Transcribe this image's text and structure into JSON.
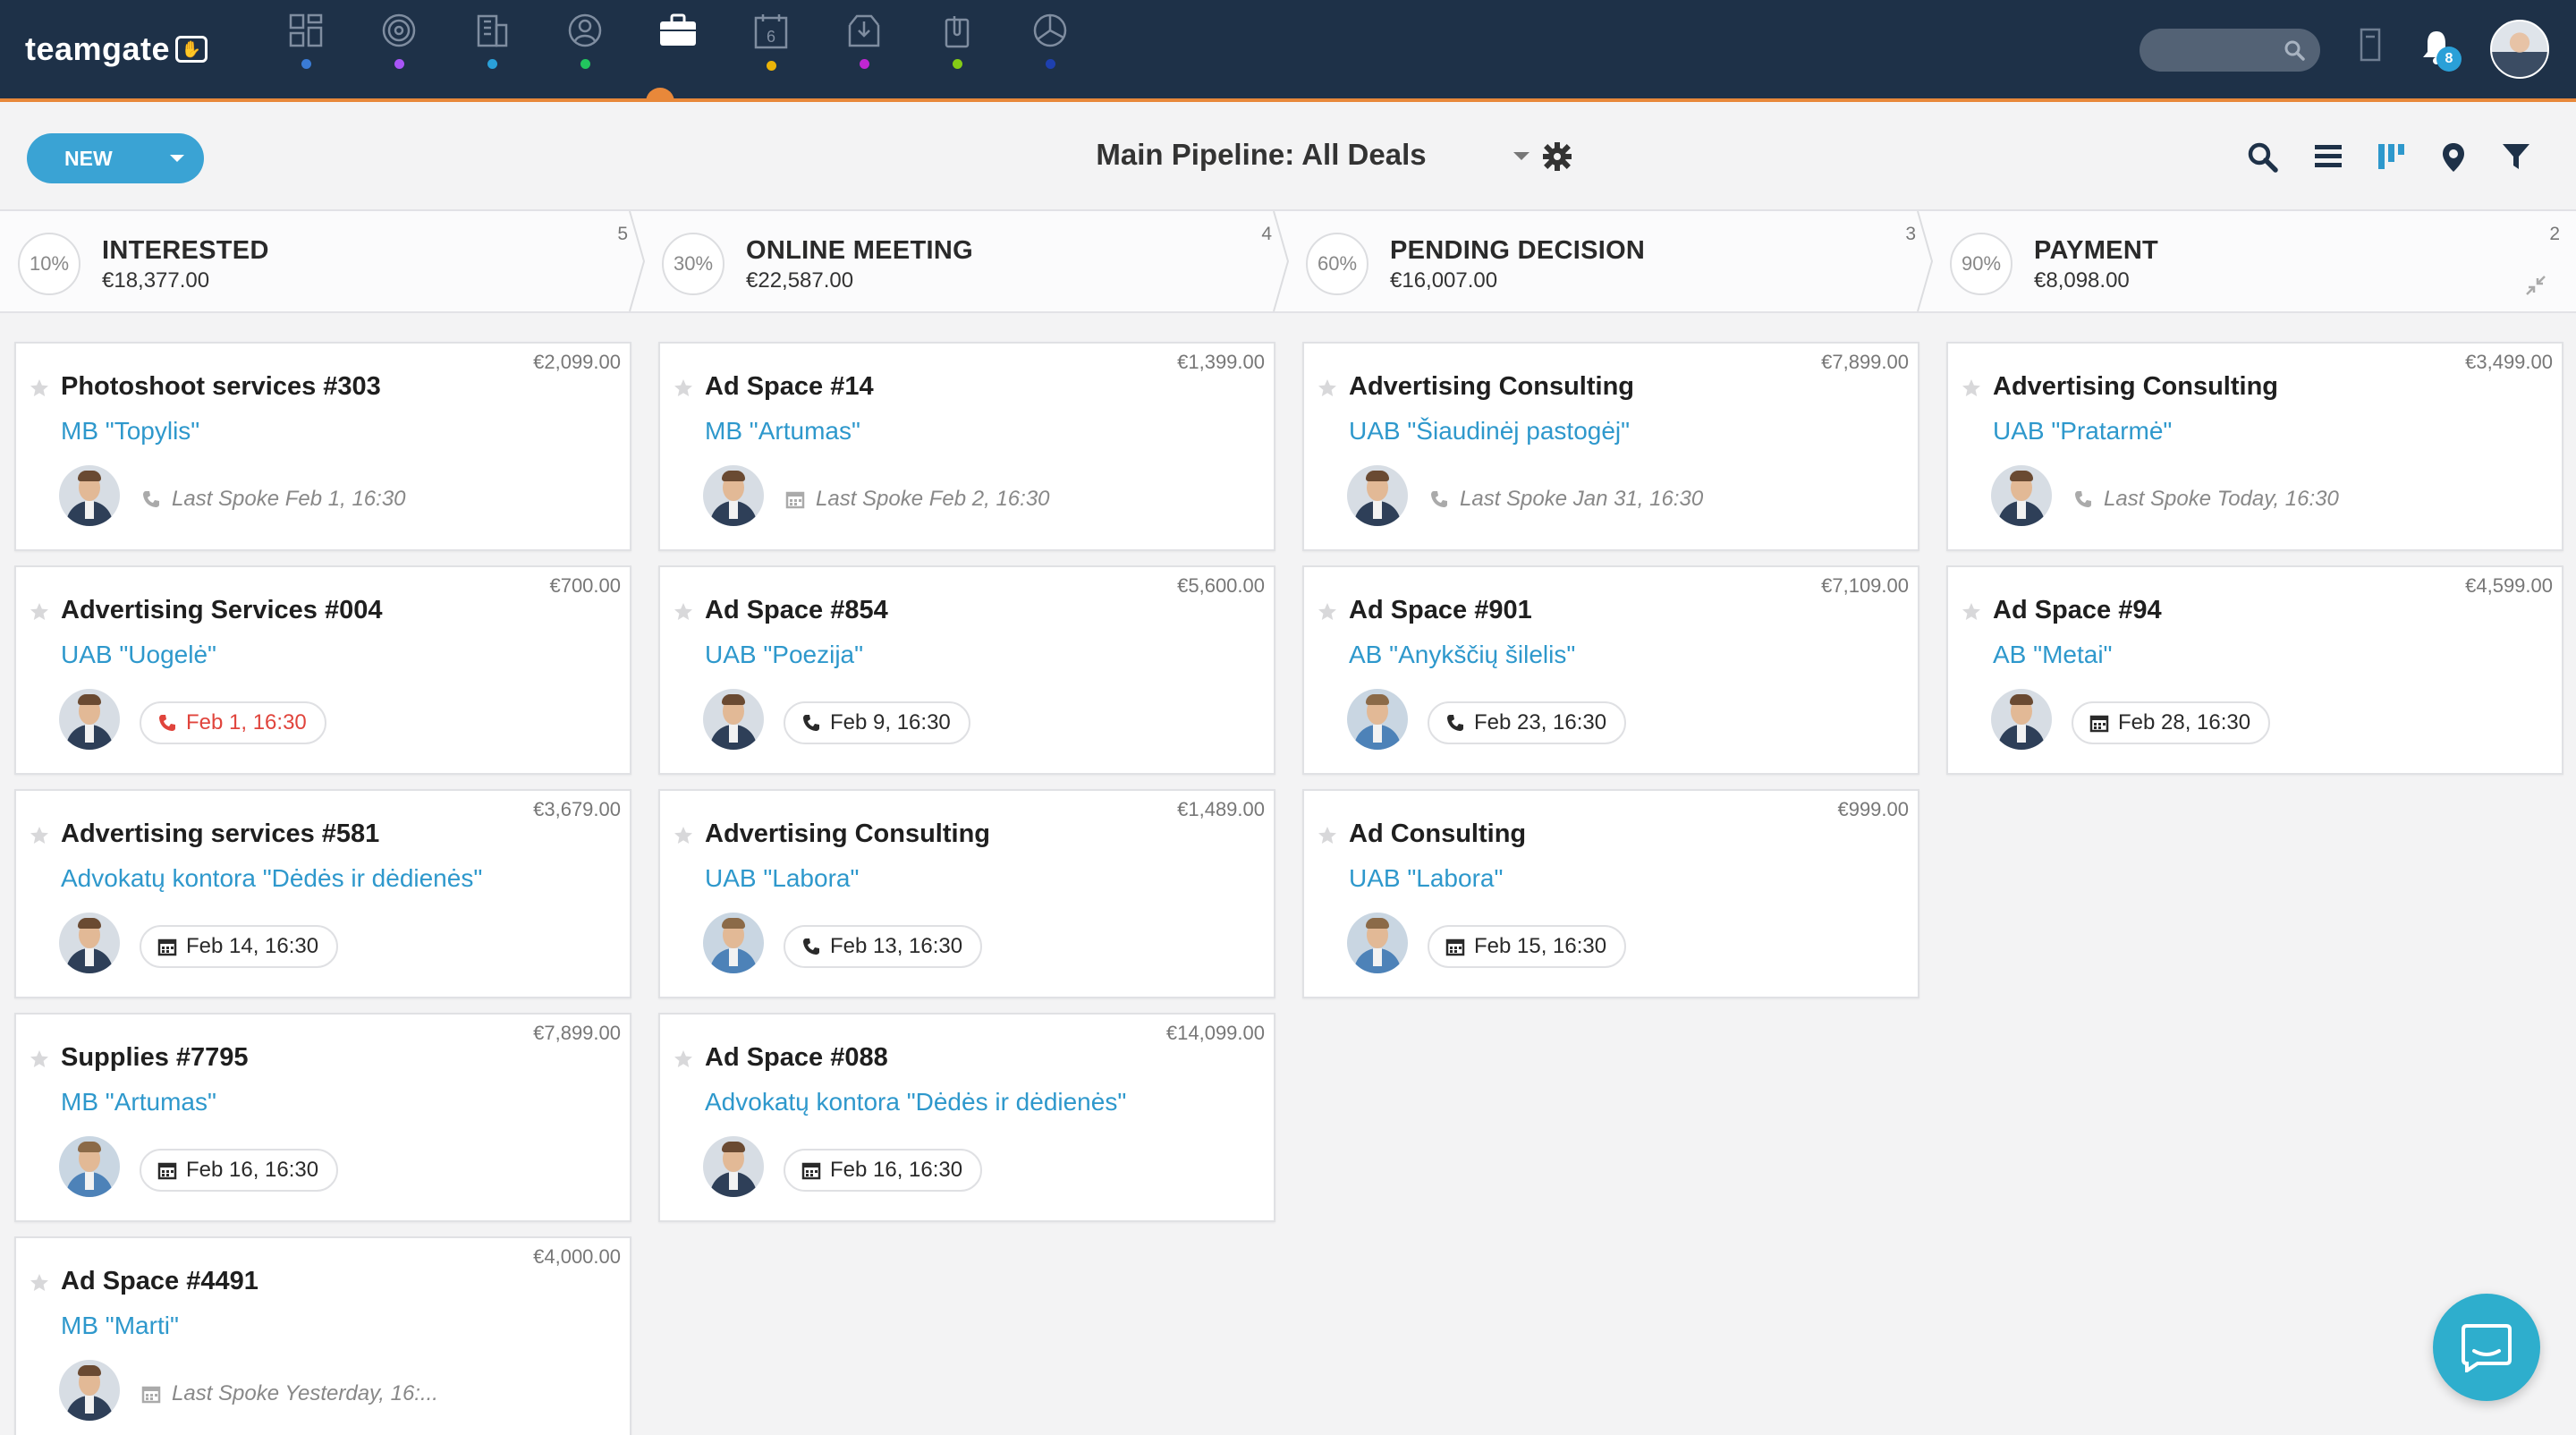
{
  "app": {
    "logo_text": "teamgate",
    "nav_items": [
      {
        "icon": "dashboard-icon",
        "dot_color": "#3a7bd5"
      },
      {
        "icon": "target-icon",
        "dot_color": "#a855f7"
      },
      {
        "icon": "companies-icon",
        "dot_color": "#2aa0d8"
      },
      {
        "icon": "people-icon",
        "dot_color": "#22c55e"
      },
      {
        "icon": "deals-briefcase-icon",
        "dot_color": "#e8883a"
      },
      {
        "icon": "calendar-icon",
        "dot_color": "#eab308",
        "text": "6"
      },
      {
        "icon": "inbox-icon",
        "dot_color": "#c026d3"
      },
      {
        "icon": "documents-icon",
        "dot_color": "#84cc16"
      },
      {
        "icon": "reports-pie-icon",
        "dot_color": "#1e40af"
      }
    ],
    "search_placeholder": "",
    "notification_count": "8"
  },
  "toolbar": {
    "new_label": "NEW",
    "pipeline_title": "Main Pipeline: All Deals"
  },
  "stages": [
    {
      "pct": "10%",
      "name": "INTERESTED",
      "amount": "€18,377.00",
      "count": "5"
    },
    {
      "pct": "30%",
      "name": "ONLINE MEETING",
      "amount": "€22,587.00",
      "count": "4"
    },
    {
      "pct": "60%",
      "name": "PENDING DECISION",
      "amount": "€16,007.00",
      "count": "3"
    },
    {
      "pct": "90%",
      "name": "PAYMENT",
      "amount": "€8,098.00",
      "count": "2"
    }
  ],
  "columns": [
    [
      {
        "amount": "€2,099.00",
        "title": "Photoshoot services #303",
        "company": "MB \"Topylis\"",
        "activity": "Last Spoke Feb 1, 16:30",
        "activity_type": "last-spoke-call",
        "avatar": "v1"
      },
      {
        "amount": "€700.00",
        "title": "Advertising Services #004",
        "company": "UAB \"Uogelė\"",
        "activity": "Feb 1, 16:30",
        "activity_type": "call-overdue",
        "avatar": "v1"
      },
      {
        "amount": "€3,679.00",
        "title": "Advertising services #581",
        "company": "Advokatų kontora \"Dėdės ir dėdienės\"",
        "activity": "Feb 14, 16:30",
        "activity_type": "meeting",
        "avatar": "v1"
      },
      {
        "amount": "€7,899.00",
        "title": "Supplies #7795",
        "company": "MB \"Artumas\"",
        "activity": "Feb 16, 16:30",
        "activity_type": "meeting",
        "avatar": "v2"
      },
      {
        "amount": "€4,000.00",
        "title": "Ad Space #4491",
        "company": "MB \"Marti\"",
        "activity": "Last Spoke Yesterday, 16:...",
        "activity_type": "last-spoke-meeting",
        "avatar": "v1"
      }
    ],
    [
      {
        "amount": "€1,399.00",
        "title": "Ad Space #14",
        "company": "MB \"Artumas\"",
        "activity": "Last Spoke Feb 2, 16:30",
        "activity_type": "last-spoke-meeting",
        "avatar": "v1"
      },
      {
        "amount": "€5,600.00",
        "title": "Ad Space #854",
        "company": "UAB \"Poezija\"",
        "activity": "Feb 9, 16:30",
        "activity_type": "call",
        "avatar": "v1"
      },
      {
        "amount": "€1,489.00",
        "title": "Advertising Consulting",
        "company": "UAB \"Labora\"",
        "activity": "Feb 13, 16:30",
        "activity_type": "call",
        "avatar": "v2"
      },
      {
        "amount": "€14,099.00",
        "title": "Ad Space #088",
        "company": "Advokatų kontora \"Dėdės ir dėdienės\"",
        "activity": "Feb 16, 16:30",
        "activity_type": "meeting",
        "avatar": "v1"
      }
    ],
    [
      {
        "amount": "€7,899.00",
        "title": "Advertising Consulting",
        "company": "UAB \"Šiaudinėj pastogėj\"",
        "activity": "Last Spoke Jan 31, 16:30",
        "activity_type": "last-spoke-call",
        "avatar": "v1"
      },
      {
        "amount": "€7,109.00",
        "title": "Ad Space #901",
        "company": "AB \"Anykščių šilelis\"",
        "activity": "Feb 23, 16:30",
        "activity_type": "call",
        "avatar": "v2"
      },
      {
        "amount": "€999.00",
        "title": "Ad Consulting",
        "company": "UAB \"Labora\"",
        "activity": "Feb 15, 16:30",
        "activity_type": "meeting",
        "avatar": "v2"
      }
    ],
    [
      {
        "amount": "€3,499.00",
        "title": "Advertising Consulting",
        "company": "UAB \"Pratarmė\"",
        "activity": "Last Spoke Today, 16:30",
        "activity_type": "last-spoke-call",
        "avatar": "v1"
      },
      {
        "amount": "€4,599.00",
        "title": "Ad Space #94",
        "company": "AB \"Metai\"",
        "activity": "Feb 28, 16:30",
        "activity_type": "meeting",
        "avatar": "v1"
      }
    ]
  ],
  "colors": {
    "topbar": "#1e3148",
    "accent_orange": "#e8883a",
    "primary_blue": "#3aa3d4",
    "company_link": "#2e98cc",
    "overdue_red": "#e0443c"
  }
}
